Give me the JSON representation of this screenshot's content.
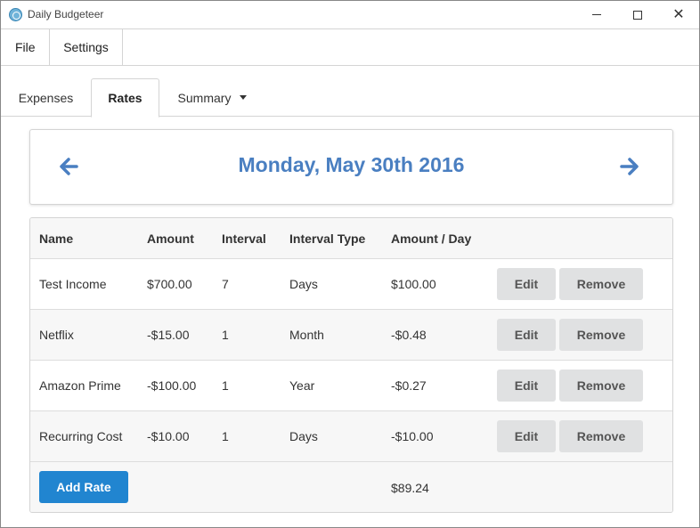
{
  "window": {
    "title": "Daily Budgeteer",
    "controls": [
      "minimize",
      "maximize",
      "close"
    ]
  },
  "menu": {
    "file": "File",
    "settings": "Settings"
  },
  "tabs": {
    "expenses": "Expenses",
    "rates": "Rates",
    "summary": "Summary",
    "active": "Rates"
  },
  "date_nav": {
    "date": "Monday, May 30th 2016",
    "prev_icon": "arrow-left-icon",
    "next_icon": "arrow-right-icon",
    "accent_color": "#4a7fc1"
  },
  "table": {
    "headers": {
      "name": "Name",
      "amount": "Amount",
      "interval": "Interval",
      "interval_type": "Interval Type",
      "amount_per_day": "Amount / Day"
    },
    "rows": [
      {
        "name": "Test Income",
        "amount": "$700.00",
        "interval": "7",
        "interval_type": "Days",
        "amount_per_day": "$100.00",
        "edit": "Edit",
        "remove": "Remove"
      },
      {
        "name": "Netflix",
        "amount": "-$15.00",
        "interval": "1",
        "interval_type": "Month",
        "amount_per_day": "-$0.48",
        "edit": "Edit",
        "remove": "Remove"
      },
      {
        "name": "Amazon Prime",
        "amount": "-$100.00",
        "interval": "1",
        "interval_type": "Year",
        "amount_per_day": "-$0.27",
        "edit": "Edit",
        "remove": "Remove"
      },
      {
        "name": "Recurring Cost",
        "amount": "-$10.00",
        "interval": "1",
        "interval_type": "Days",
        "amount_per_day": "-$10.00",
        "edit": "Edit",
        "remove": "Remove"
      }
    ],
    "footer": {
      "add_label": "Add Rate",
      "total": "$89.24"
    }
  },
  "colors": {
    "primary_button": "#2185d0",
    "secondary_button": "#e0e1e2"
  }
}
